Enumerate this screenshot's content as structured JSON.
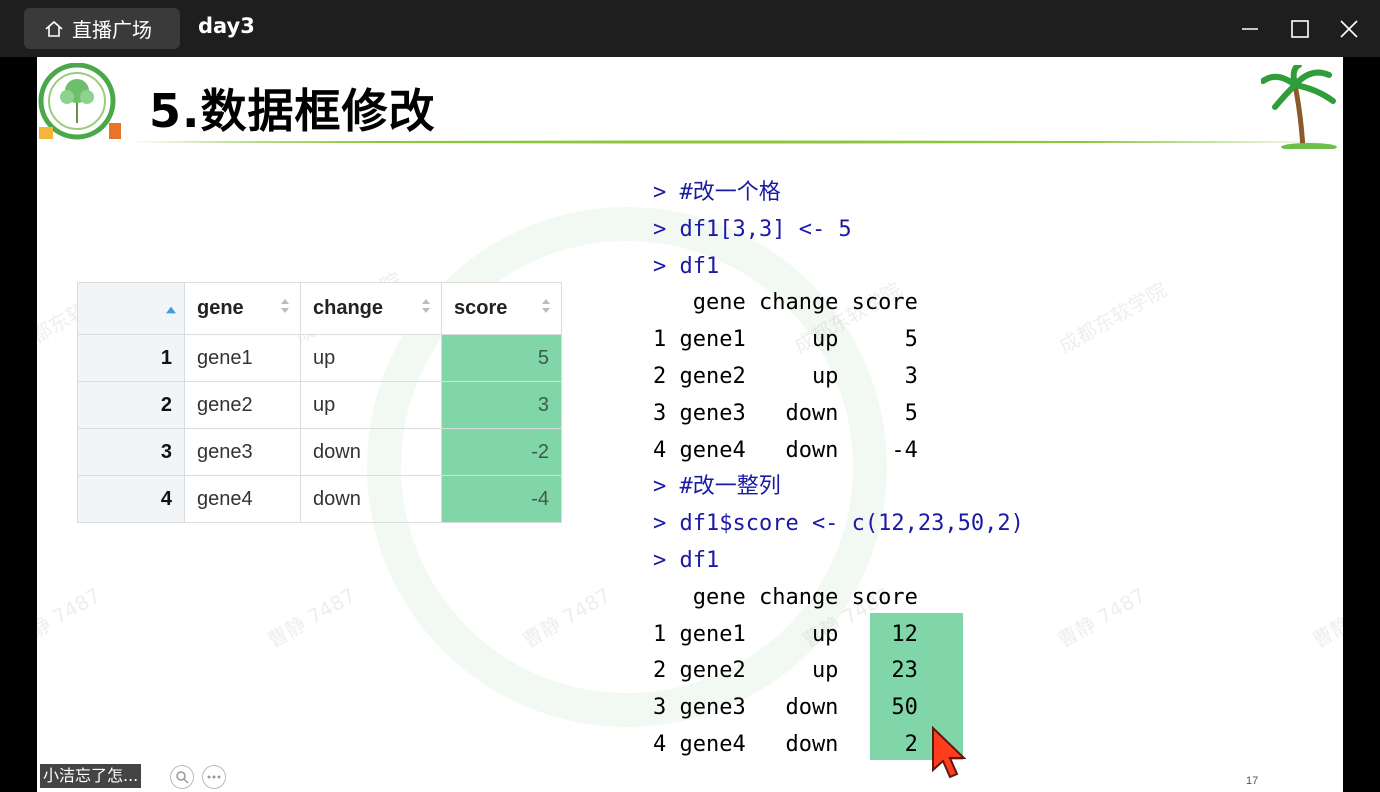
{
  "titlebar": {
    "home_label": "直播广场",
    "doc_title": "day3"
  },
  "slide": {
    "title": "5.数据框修改",
    "page_number": "17"
  },
  "watermarks": [
    "成都东软学院",
    "成都东软学院",
    "成都东软学院",
    "成都东软学院",
    "曹静 7487",
    "曹静 7487",
    "曹静 7487",
    "曹静 7487",
    "曹静 7487",
    "曹静 7487"
  ],
  "data_viewer": {
    "headers": [
      "",
      "gene",
      "change",
      "score"
    ],
    "rows": [
      {
        "idx": "1",
        "gene": "gene1",
        "change": "up",
        "score": "5"
      },
      {
        "idx": "2",
        "gene": "gene2",
        "change": "up",
        "score": "3"
      },
      {
        "idx": "3",
        "gene": "gene3",
        "change": "down",
        "score": "-2"
      },
      {
        "idx": "4",
        "gene": "gene4",
        "change": "down",
        "score": "-4"
      }
    ]
  },
  "console": [
    {
      "type": "cmd",
      "text": "> #改一个格"
    },
    {
      "type": "cmd",
      "text": "> df1[3,3] <- 5"
    },
    {
      "type": "cmd",
      "text": "> df1"
    },
    {
      "type": "out",
      "text": "   gene change score"
    },
    {
      "type": "out",
      "text": "1 gene1     up     5"
    },
    {
      "type": "out",
      "text": "2 gene2     up     3"
    },
    {
      "type": "out",
      "text": "3 gene3   down     5"
    },
    {
      "type": "out",
      "text": "4 gene4   down    -4"
    },
    {
      "type": "cmd",
      "text": "> #改一整列"
    },
    {
      "type": "cmd",
      "text": "> df1$score <- c(12,23,50,2)"
    },
    {
      "type": "cmd",
      "text": "> df1"
    },
    {
      "type": "out",
      "text": "   gene change score"
    },
    {
      "type": "out",
      "text": "1 gene1     up    12"
    },
    {
      "type": "out",
      "text": "2 gene2     up    23"
    },
    {
      "type": "out",
      "text": "3 gene3   down    50"
    },
    {
      "type": "out",
      "text": "4 gene4   down     2"
    }
  ],
  "overlay": {
    "notice": "小洁忘了怎...",
    "icons": [
      "search-icon",
      "more-icon"
    ]
  }
}
